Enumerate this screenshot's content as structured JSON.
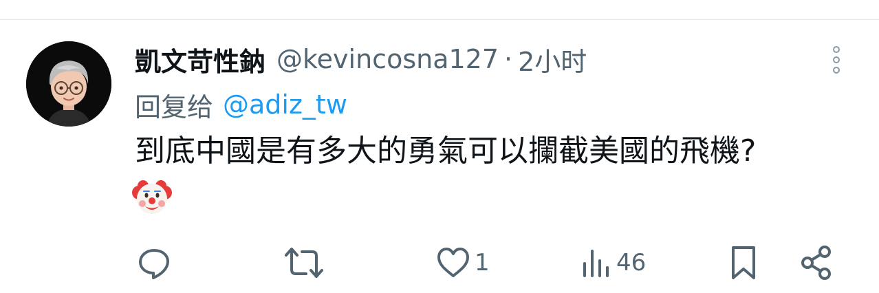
{
  "tweet": {
    "display_name": "凱文苛性鈉",
    "handle": "@kevincosna127",
    "separator": "·",
    "time": "2小时",
    "reply_label": "回复给",
    "reply_to": "@adiz_tw",
    "text": "到底中國是有多大的勇氣可以攔截美國的飛機?",
    "emoji_icon": "clown-face-icon"
  },
  "actions": {
    "reply_icon": "reply-icon",
    "retweet_icon": "retweet-icon",
    "like_icon": "heart-icon",
    "like_count": "1",
    "views_icon": "views-icon",
    "views_count": "46",
    "bookmark_icon": "bookmark-icon",
    "share_icon": "share-icon"
  },
  "colors": {
    "text_primary": "#0f1419",
    "text_secondary": "#536471",
    "link": "#1d9bf0",
    "divider": "#e7e9ea"
  }
}
